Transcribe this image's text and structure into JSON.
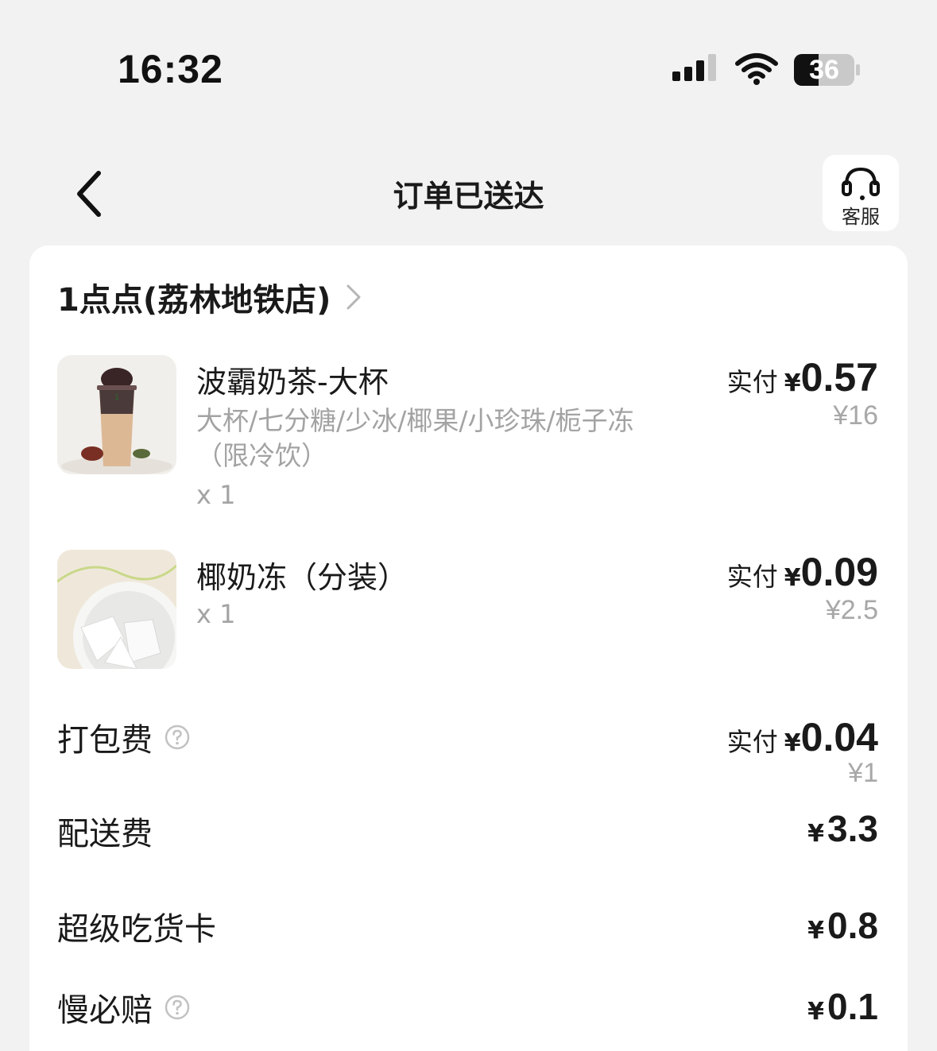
{
  "status_bar": {
    "time": "16:32",
    "battery": "36"
  },
  "nav": {
    "title": "订单已送达",
    "service_label": "客服"
  },
  "store": {
    "name": "1点点(荔林地铁店)"
  },
  "items": [
    {
      "name": "波霸奶茶-大杯",
      "spec": "大杯/七分糖/少冰/椰果/小珍珠/栀子冻（限冷饮）",
      "qty": "x 1",
      "paid_label": "实付",
      "paid_symbol": "¥",
      "paid_amount": "0.57",
      "original": "¥16"
    },
    {
      "name": "椰奶冻（分装）",
      "qty": "x 1",
      "paid_label": "实付",
      "paid_symbol": "¥",
      "paid_amount": "0.09",
      "original": "¥2.5"
    }
  ],
  "fees": [
    {
      "label": "打包费",
      "has_help": true,
      "paid_label": "实付",
      "symbol": "¥",
      "amount": "0.04",
      "original": "¥1"
    },
    {
      "label": "配送费",
      "has_help": false,
      "symbol": "¥",
      "amount": "3.3"
    },
    {
      "label": "超级吃货卡",
      "has_help": false,
      "symbol": "¥",
      "amount": "0.8"
    },
    {
      "label": "慢必赔",
      "has_help": true,
      "symbol": "¥",
      "amount": "0.1"
    }
  ],
  "icons": {
    "back": "chevron-left-icon",
    "service": "headset-icon",
    "store_arrow": "chevron-right-icon",
    "help": "question-circle-icon"
  }
}
